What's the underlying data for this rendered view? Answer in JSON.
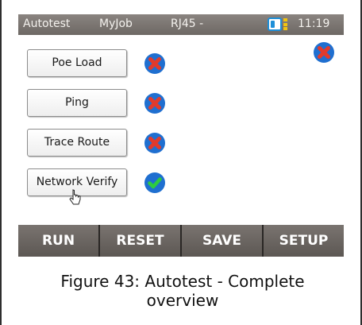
{
  "status_bar": {
    "title": "Autotest",
    "job": "MyJob",
    "port": "RJ45 -",
    "time": "11:19"
  },
  "tests": [
    {
      "label": "Poe Load",
      "status": "fail"
    },
    {
      "label": "Ping",
      "status": "fail"
    },
    {
      "label": "Trace Route",
      "status": "fail"
    },
    {
      "label": "Network Verify",
      "status": "pass"
    }
  ],
  "overall_status": "fail",
  "toolbar": {
    "run": "RUN",
    "reset": "RESET",
    "save": "SAVE",
    "setup": "SETUP"
  },
  "caption": {
    "line1": "Figure 43: Autotest - Complete",
    "line2": "overview"
  },
  "colors": {
    "fail_fill": "#1f6fd0",
    "fail_x": "#e23a2c",
    "pass_fill": "#1f6fd0",
    "pass_check": "#2ecc40",
    "toolbar_bg": "#6b6662",
    "battery": "#1e8fd8",
    "battery_dots": "#f1c40f"
  }
}
